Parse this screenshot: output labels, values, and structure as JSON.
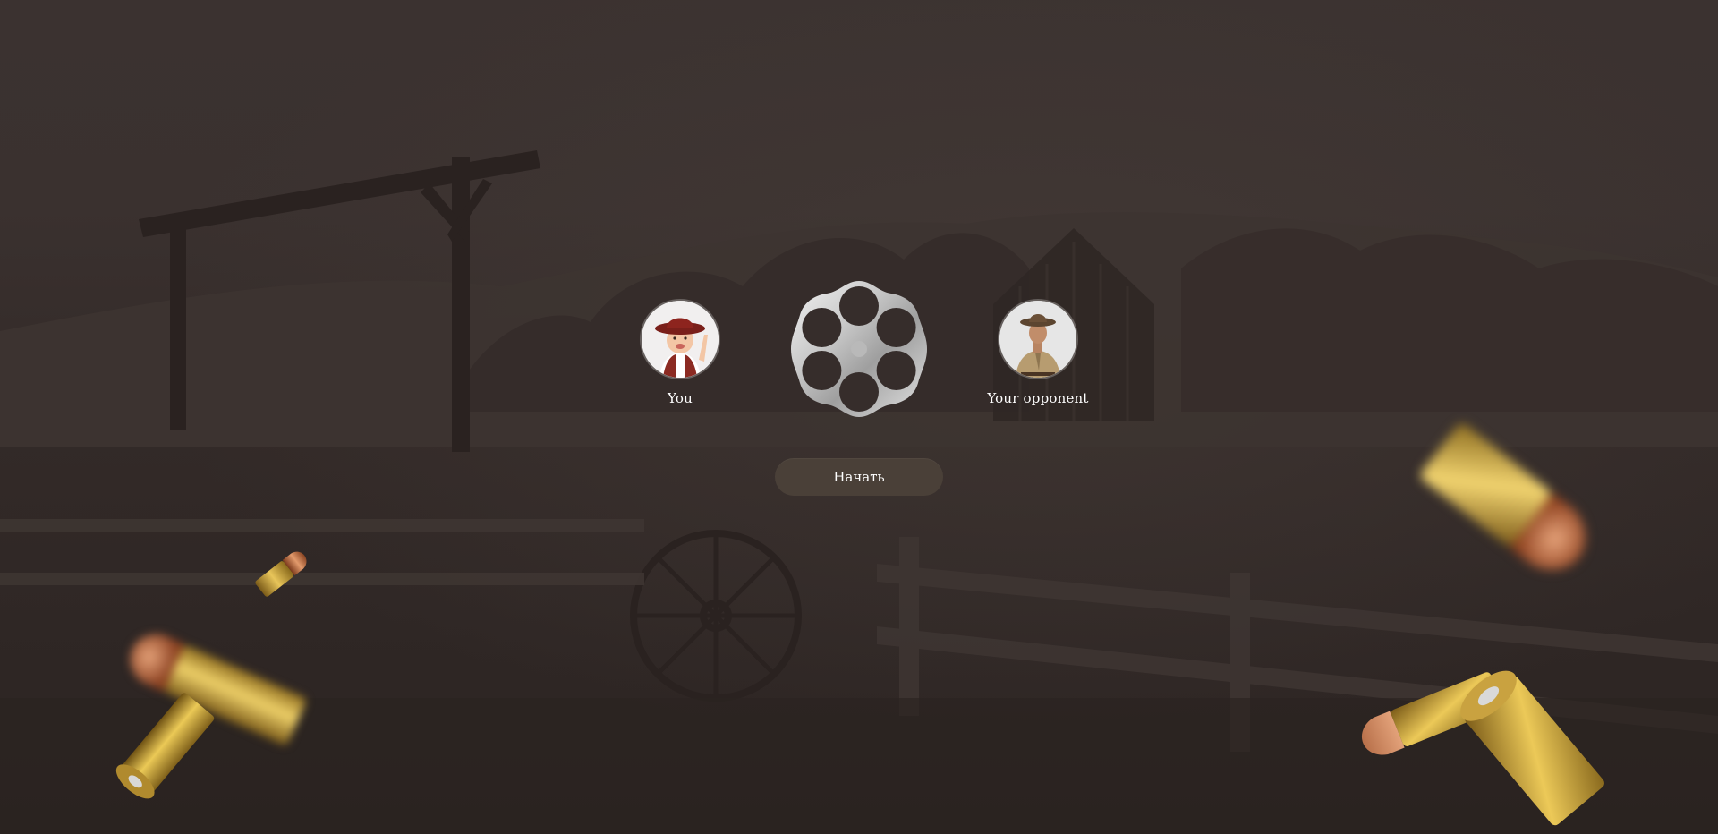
{
  "players": {
    "you": {
      "label": "You",
      "avatar_icon": "child-cowboy-avatar"
    },
    "opponent": {
      "label": "Your opponent",
      "avatar_icon": "cowboy-man-avatar"
    }
  },
  "cylinder": {
    "icon": "revolver-cylinder-icon",
    "chambers": 6
  },
  "start_button": {
    "label": "Начать"
  },
  "colors": {
    "background": "#3a302e",
    "button": "#4a4038",
    "text": "#ffffff",
    "brass": "#c9a23a",
    "copper": "#b8643a"
  }
}
